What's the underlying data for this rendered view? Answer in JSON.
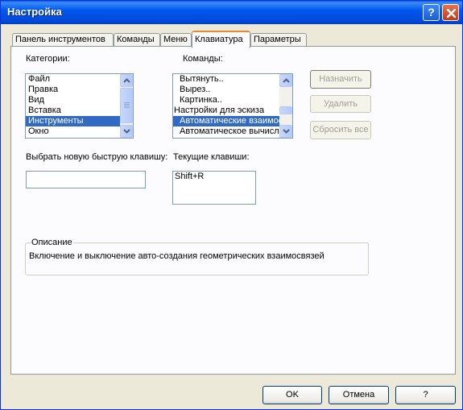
{
  "window": {
    "title": "Настройка",
    "help_glyph": "?"
  },
  "tabs": [
    {
      "label": "Панель инструментов",
      "active": false
    },
    {
      "label": "Команды",
      "active": false
    },
    {
      "label": "Меню",
      "active": false
    },
    {
      "label": "Клавиатура",
      "active": true
    },
    {
      "label": "Параметры",
      "active": false
    }
  ],
  "categories": {
    "label": "Категории:",
    "items": [
      "Файл",
      "Правка",
      "Вид",
      "Вставка",
      "Инструменты",
      "Окно"
    ],
    "selected": "Инструменты"
  },
  "commands": {
    "label": "Команды:",
    "items": [
      "Вытянуть..",
      "Вырез..",
      "Картинка..",
      "Настройки для эскиза",
      "Автоматические взаимосвязи",
      "Автоматическое вычисление"
    ],
    "selected": "Автоматические взаимосвязи"
  },
  "buttons": {
    "assign": "Назначить",
    "delete": "Удалить",
    "reset_all": "Сбросить все"
  },
  "new_shortcut": {
    "label": "Выбрать новую быструю клавишу:",
    "value": ""
  },
  "current_keys": {
    "label": "Текущие клавиши:",
    "items": [
      "Shift+R"
    ]
  },
  "description": {
    "title": "Описание",
    "text": "Включение и выключение авто-создания геометрических взаимосвязей"
  },
  "footer": {
    "ok": "OK",
    "cancel": "Отмена",
    "help": "?"
  },
  "colors": {
    "titlebar": "#0058ee",
    "selection": "#316ac5",
    "tab_highlight": "#e68b2c"
  }
}
